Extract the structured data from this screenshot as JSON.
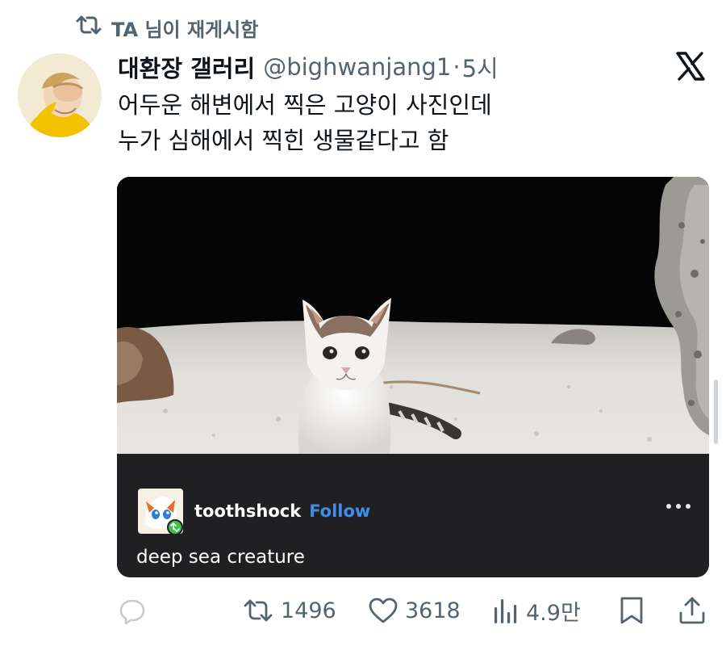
{
  "retweet": {
    "label": "TA 님이 재게시함",
    "icon": "repost-icon"
  },
  "tweet": {
    "display_name": "대환장 갤러리",
    "handle": "@bighwanjang1",
    "separator": "·",
    "time": "5시",
    "text_lines": [
      "어두운 해변에서 찍은 고양이 사진인데",
      "누가 심해에서 찍힌 생물같다고 함"
    ]
  },
  "embedded": {
    "username": "toothshock",
    "follow_label": "Follow",
    "caption": "deep sea creature",
    "more_icon": "more-dots-icon"
  },
  "actions": {
    "reply": {
      "icon": "reply-icon",
      "count": ""
    },
    "repost": {
      "icon": "repost-icon",
      "count": "1496"
    },
    "like": {
      "icon": "heart-icon",
      "count": "3618"
    },
    "views": {
      "icon": "views-chart-icon",
      "count": "4.9만"
    },
    "bookmark": {
      "icon": "bookmark-icon"
    },
    "share": {
      "icon": "share-icon"
    }
  },
  "colors": {
    "muted": "#536471",
    "text": "#0f1419",
    "follow": "#3f8ee6",
    "card_bg": "#202022"
  }
}
